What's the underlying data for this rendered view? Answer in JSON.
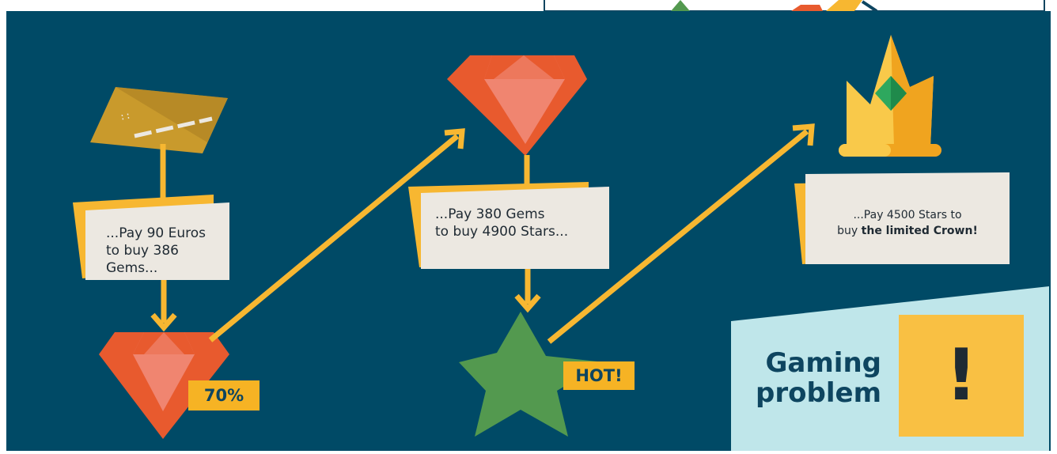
{
  "steps": {
    "step1": {
      "line1": "...Pay 90 Euros",
      "line2": "to buy 386 Gems..."
    },
    "step2": {
      "line1": "...Pay 380 Gems",
      "line2": "to buy 4900 Stars..."
    },
    "step3": {
      "line1": "...Pay 4500 Stars to",
      "line2_prefix": "buy ",
      "line2_bold": "the limited Crown!"
    }
  },
  "badges": {
    "gem": "70%",
    "star": "HOT!"
  },
  "callout": {
    "line1": "Gaming",
    "line2": "problem",
    "mark": "!"
  },
  "colors": {
    "background": "#004a66",
    "arrow": "#f7b731",
    "gem_dark": "#e85a2e",
    "gem_light": "#f08570",
    "star": "#53994f",
    "crown": "#f9c94a",
    "crown_shadow": "#f0a41f",
    "crown_jewel": "#2ea85e",
    "card": "#ece8e1",
    "card_shadow": "#f7b731",
    "callout_bg": "#bfe6ea",
    "callout_box": "#f9c043",
    "badge": "#f6b324"
  },
  "icons": [
    "credit-card-icon",
    "gem-icon",
    "star-icon",
    "crown-icon",
    "arrow-icon"
  ]
}
